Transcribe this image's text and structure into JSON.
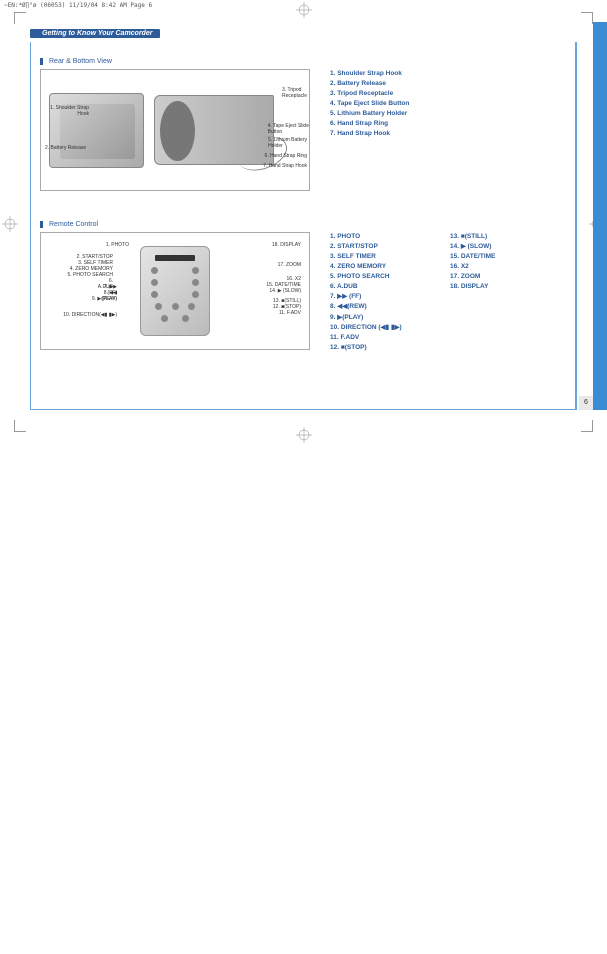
{
  "header_line": "~EN:*Ø∏°ø (06053)  11/19/04 8:42 AM  Page 6",
  "section_title": "Getting to Know Your Camcorder",
  "rear_bottom": {
    "heading": "Rear & Bottom View",
    "diagram_labels": {
      "l1": "1. Shoulder Strap\nHook",
      "l2": "2. Battery Release",
      "l3": "3. Tripod\nReceptacle",
      "l4": "4. Tape Eject Slide\nButton",
      "l5": "5. Lithium Battery\nHolder",
      "l6": "6. Hand Strap Ring",
      "l7": "7. Hand Strap Hook"
    },
    "list": [
      "1. Shoulder Strap Hook",
      "2. Battery Release",
      "3. Tripod Receptacle",
      "4. Tape Eject Slide Button",
      "5. Lithium Battery Holder",
      "6. Hand Strap Ring",
      "7. Hand Strap Hook"
    ]
  },
  "remote": {
    "heading": "Remote Control",
    "diagram_labels": {
      "l1": "1. PHOTO",
      "l2": "2. START/STOP",
      "l3": "3. SELF TIMER",
      "l4": "4. ZERO MEMORY",
      "l5": "5. PHOTO SEARCH",
      "l6": "6. A.DUB",
      "l7": "7. ▶▶ (FF)",
      "l8": "8. ◀◀ (REW)",
      "l9": "9. ▶(PLAY)",
      "l10": "10. DIRECTION(◀▮ ▮▶)",
      "l11": "11. F.ADV",
      "l12": "12. ■(STOP)",
      "l13": "13. ■(STILL)",
      "l14": "14. ▶ (SLOW)",
      "l15": "15. DATE/TIME",
      "l16": "16. X2",
      "l17": "17. ZOOM",
      "l18": "18. DISPLAY"
    },
    "list_a": [
      "1. PHOTO",
      "2. START/STOP",
      "3. SELF TIMER",
      "4. ZERO MEMORY",
      "5. PHOTO SEARCH",
      "6. A.DUB",
      "7. ▶▶ (FF)",
      "8. ◀◀(REW)",
      "9. ▶(PLAY)",
      "10. DIRECTION (◀▮ ▮▶)",
      "11. F.ADV",
      "12. ■(STOP)"
    ],
    "list_b": [
      "13. ■(STILL)",
      "14. ▶ (SLOW)",
      "15. DATE/TIME",
      "16. X2",
      "17. ZOOM",
      "18. DISPLAY"
    ]
  },
  "page_number": "6"
}
